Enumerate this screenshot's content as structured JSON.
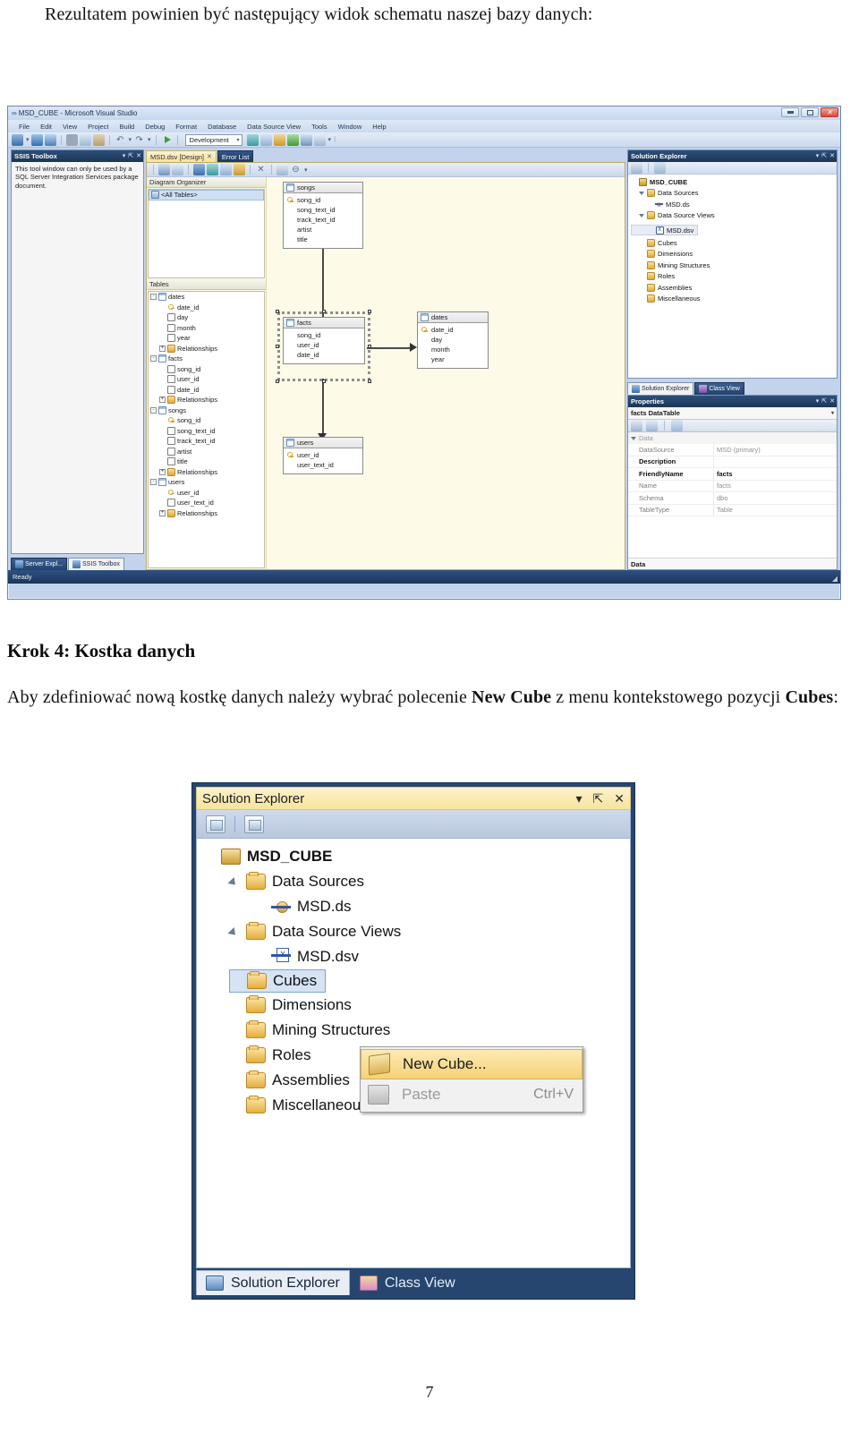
{
  "document": {
    "intro_paragraph": "Rezultatem powinien być następujący widok schematu naszej bazy danych:",
    "step_heading": "Krok 4: Kostka danych",
    "step_paragraph_part1": "Aby zdefiniować nową kostkę danych należy wybrać polecenie ",
    "step_paragraph_bold1": "New Cube",
    "step_paragraph_part2": " z menu kontekstowego pozycji ",
    "step_paragraph_bold2": "Cubes",
    "step_paragraph_part3": ":",
    "page_number": "7"
  },
  "vs_window": {
    "title": "MSD_CUBE - Microsoft Visual Studio",
    "window_buttons": {
      "minimize": "_",
      "maximize": "□",
      "close": "×"
    },
    "menu_items": [
      "File",
      "Edit",
      "View",
      "Project",
      "Build",
      "Debug",
      "Format",
      "Database",
      "Data Source View",
      "Tools",
      "Window",
      "Help"
    ],
    "toolbar": {
      "config_combo_value": "Development"
    },
    "status_bar": {
      "text": "Ready"
    },
    "toolbox_pane": {
      "title": "SSIS Toolbox",
      "message": "This tool window can only be used by a SQL Server Integration Services package document.",
      "buttons": {
        "dropdown": "▾",
        "pin": "⇱",
        "close": "✕"
      }
    },
    "left_dock_tabs": [
      {
        "label": "Server Expl...",
        "active": false
      },
      {
        "label": "SSIS Toolbox",
        "active": true
      }
    ],
    "document_tabs": [
      {
        "label": "MSD.dsv [Design]",
        "active": true,
        "close": "✕"
      },
      {
        "label": "Error List",
        "active": false
      }
    ],
    "diagram_organizer": {
      "section_title": "Diagram Organizer",
      "items": [
        "<All Tables>"
      ]
    },
    "tables_section": {
      "section_title": "Tables",
      "tree": [
        {
          "label": "dates",
          "type": "table",
          "expander": "-",
          "level": 0
        },
        {
          "label": "date_id",
          "type": "key",
          "level": 1
        },
        {
          "label": "day",
          "type": "column",
          "level": 1
        },
        {
          "label": "month",
          "type": "column",
          "level": 1
        },
        {
          "label": "year",
          "type": "column",
          "level": 1
        },
        {
          "label": "Relationships",
          "type": "folder",
          "expander": "+",
          "level": 1
        },
        {
          "label": "facts",
          "type": "table",
          "expander": "-",
          "level": 0
        },
        {
          "label": "song_id",
          "type": "column",
          "level": 1
        },
        {
          "label": "user_id",
          "type": "column",
          "level": 1
        },
        {
          "label": "date_id",
          "type": "column",
          "level": 1
        },
        {
          "label": "Relationships",
          "type": "folder",
          "expander": "+",
          "level": 1
        },
        {
          "label": "songs",
          "type": "table",
          "expander": "-",
          "level": 0
        },
        {
          "label": "song_id",
          "type": "key",
          "level": 1
        },
        {
          "label": "song_text_id",
          "type": "column",
          "level": 1
        },
        {
          "label": "track_text_id",
          "type": "column",
          "level": 1
        },
        {
          "label": "artist",
          "type": "column",
          "level": 1
        },
        {
          "label": "title",
          "type": "column",
          "level": 1
        },
        {
          "label": "Relationships",
          "type": "folder",
          "expander": "+",
          "level": 1
        },
        {
          "label": "users",
          "type": "table",
          "expander": "-",
          "level": 0
        },
        {
          "label": "user_id",
          "type": "key",
          "level": 1
        },
        {
          "label": "user_text_id",
          "type": "column",
          "level": 1
        },
        {
          "label": "Relationships",
          "type": "folder",
          "expander": "+",
          "level": 1
        }
      ]
    },
    "diagram": {
      "tables": [
        {
          "name": "songs",
          "columns": [
            "song_id",
            "song_text_id",
            "track_text_id",
            "artist",
            "title"
          ],
          "key_column": "song_id",
          "selected": false
        },
        {
          "name": "facts",
          "columns": [
            "song_id",
            "user_id",
            "date_id"
          ],
          "key_column": null,
          "selected": true
        },
        {
          "name": "dates",
          "columns": [
            "date_id",
            "day",
            "month",
            "year"
          ],
          "key_column": "date_id",
          "selected": false
        },
        {
          "name": "users",
          "columns": [
            "user_id",
            "user_text_id"
          ],
          "key_column": "user_id",
          "selected": false
        }
      ],
      "relationships": [
        {
          "from": "facts",
          "to": "songs"
        },
        {
          "from": "facts",
          "to": "dates"
        },
        {
          "from": "facts",
          "to": "users"
        }
      ]
    },
    "solution_explorer": {
      "title": "Solution Explorer",
      "buttons": {
        "dropdown": "▾",
        "pin": "⇱"
      },
      "tree": [
        {
          "label": "MSD_CUBE",
          "icon": "project-icon",
          "level": 0,
          "expander": "none",
          "bold": true
        },
        {
          "label": "Data Sources",
          "icon": "folder-icon",
          "level": 1,
          "expander": "collapse"
        },
        {
          "label": "MSD.ds",
          "icon": "datasource-icon",
          "level": 2,
          "expander": "none"
        },
        {
          "label": "Data Source Views",
          "icon": "folder-icon",
          "level": 1,
          "expander": "collapse"
        },
        {
          "label": "MSD.dsv",
          "icon": "datasourceview-icon",
          "level": 2,
          "expander": "none",
          "selected": true
        },
        {
          "label": "Cubes",
          "icon": "folder-icon",
          "level": 1,
          "expander": "none"
        },
        {
          "label": "Dimensions",
          "icon": "folder-icon",
          "level": 1,
          "expander": "none"
        },
        {
          "label": "Mining Structures",
          "icon": "folder-icon",
          "level": 1,
          "expander": "none"
        },
        {
          "label": "Roles",
          "icon": "folder-icon",
          "level": 1,
          "expander": "none"
        },
        {
          "label": "Assemblies",
          "icon": "folder-icon",
          "level": 1,
          "expander": "none"
        },
        {
          "label": "Miscellaneous",
          "icon": "folder-icon",
          "level": 1,
          "expander": "none"
        }
      ],
      "bottom_tabs": [
        {
          "label": "Solution Explorer",
          "active": true
        },
        {
          "label": "Class View",
          "active": false
        }
      ]
    },
    "properties_pane": {
      "title": "Properties",
      "buttons": {
        "dropdown": "▾",
        "pin": "⇱",
        "close": "✕"
      },
      "object_name": "facts DataTable",
      "category": "Data",
      "rows": [
        {
          "key": "DataSource",
          "value": "MSD (primary)",
          "bold": false
        },
        {
          "key": "Description",
          "value": "",
          "bold": true
        },
        {
          "key": "FriendlyName",
          "value": "facts",
          "bold": true
        },
        {
          "key": "Name",
          "value": "facts",
          "bold": false
        },
        {
          "key": "Schema",
          "value": "dbo",
          "bold": false
        },
        {
          "key": "TableType",
          "value": "Table",
          "bold": false
        }
      ],
      "footer": "Data"
    }
  },
  "figure2": {
    "panel_title": "Solution Explorer",
    "header_buttons": {
      "dropdown": "▾",
      "pin": "⇱",
      "close": "✕"
    },
    "tree": [
      {
        "label": "MSD_CUBE",
        "icon": "project-icon",
        "level": 0,
        "expander": "none",
        "bold": true
      },
      {
        "label": "Data Sources",
        "icon": "folder-icon",
        "level": 1,
        "expander": "collapse"
      },
      {
        "label": "MSD.ds",
        "icon": "datasource-icon",
        "level": 2,
        "expander": "none"
      },
      {
        "label": "Data Source Views",
        "icon": "folder-icon",
        "level": 1,
        "expander": "collapse"
      },
      {
        "label": "MSD.dsv",
        "icon": "datasourceview-icon",
        "level": 2,
        "expander": "none"
      },
      {
        "label": "Cubes",
        "icon": "folder-icon",
        "level": 1,
        "expander": "none",
        "highlighted": true
      },
      {
        "label": "Dimensions",
        "icon": "folder-icon",
        "level": 1,
        "expander": "none"
      },
      {
        "label": "Mining Structures",
        "icon": "folder-icon",
        "level": 1,
        "expander": "none"
      },
      {
        "label": "Roles",
        "icon": "folder-icon",
        "level": 1,
        "expander": "none"
      },
      {
        "label": "Assemblies",
        "icon": "folder-icon",
        "level": 1,
        "expander": "none"
      },
      {
        "label": "Miscellaneous",
        "icon": "folder-icon",
        "level": 1,
        "expander": "none"
      }
    ],
    "context_menu": {
      "items": [
        {
          "label": "New Cube...",
          "icon": "cube-icon",
          "shortcut": "",
          "selected": true,
          "disabled": false
        },
        {
          "label": "Paste",
          "icon": "paste-icon",
          "shortcut": "Ctrl+V",
          "selected": false,
          "disabled": true
        }
      ]
    },
    "bottom_tabs": [
      {
        "label": "Solution Explorer",
        "active": true
      },
      {
        "label": "Class View",
        "active": false
      }
    ]
  },
  "colors": {
    "vs_chrome": "#c3d3ec",
    "pane_header": "#1d3556",
    "accent_tab": "#f6e39c",
    "canvas": "#fdfbe8",
    "menu_highlight": "#f6d277",
    "tree_selection": "#d5e3f5",
    "dock_dark": "#26466f"
  }
}
